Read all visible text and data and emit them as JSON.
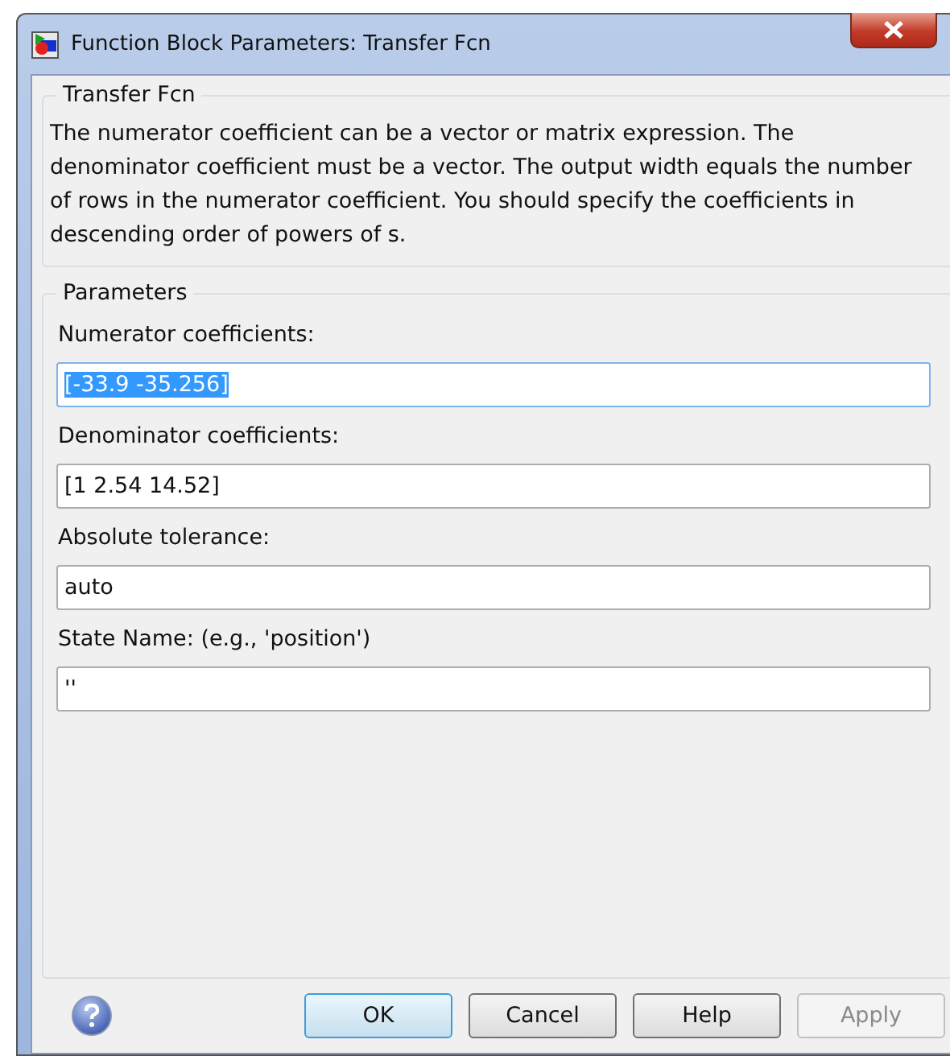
{
  "window": {
    "title": "Function Block Parameters: Transfer Fcn"
  },
  "description_group": {
    "title": "Transfer Fcn",
    "text": "The numerator coefficient can be a vector or matrix expression. The denominator coefficient must be a vector. The output width equals the number of rows in the numerator coefficient. You should specify the coefficients in descending order of powers of s."
  },
  "parameters_group": {
    "title": "Parameters",
    "fields": [
      {
        "label": "Numerator coefficients:",
        "value": "[-33.9 -35.256]",
        "selected": true
      },
      {
        "label": "Denominator coefficients:",
        "value": "[1 2.54 14.52]",
        "selected": false
      },
      {
        "label": "Absolute tolerance:",
        "value": "auto",
        "selected": false
      },
      {
        "label": "State Name: (e.g., 'position')",
        "value": "''",
        "selected": false
      }
    ]
  },
  "buttons": [
    {
      "label": "OK",
      "default": true,
      "disabled": false
    },
    {
      "label": "Cancel",
      "default": false,
      "disabled": false
    },
    {
      "label": "Help",
      "default": false,
      "disabled": false
    },
    {
      "label": "Apply",
      "default": false,
      "disabled": true
    }
  ]
}
